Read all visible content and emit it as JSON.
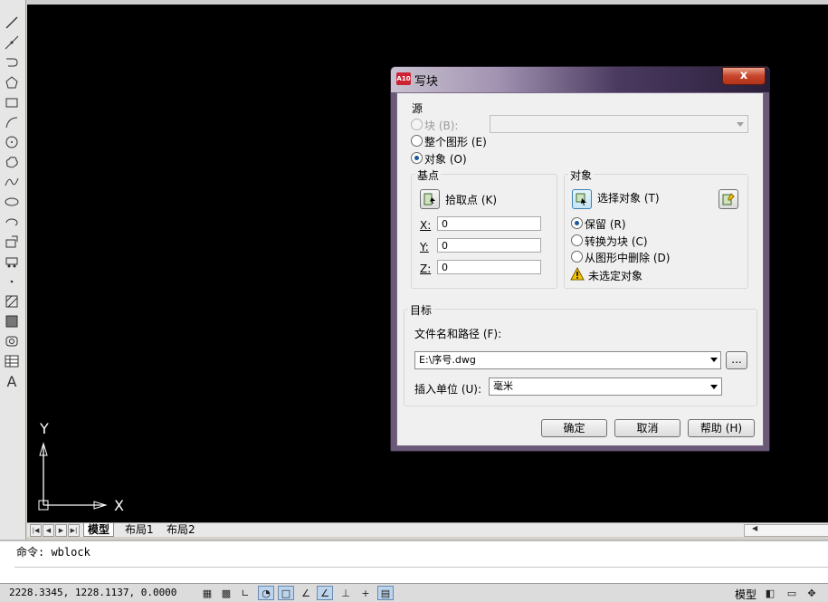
{
  "layout_tabs": [
    "模型",
    "布局1",
    "布局2"
  ],
  "command": {
    "text": "命令: wblock"
  },
  "status": {
    "coords": "2228.3345, 1228.1137, 0.0000",
    "space": "模型"
  },
  "ucs": {
    "x_label": "X",
    "y_label": "Y"
  },
  "dialog": {
    "title": "写块",
    "close_label": "x",
    "source": {
      "label": "源",
      "block_label": "块 (B):",
      "entire_label": "整个图形 (E)",
      "objects_label": "对象 (O)",
      "selected": "objects"
    },
    "base_point": {
      "label": "基点",
      "pick_label": "拾取点 (K)",
      "x_label": "X:",
      "x_value": "0",
      "y_label": "Y:",
      "y_value": "0",
      "z_label": "Z:",
      "z_value": "0"
    },
    "objects": {
      "label": "对象",
      "select_label": "选择对象 (T)",
      "retain_label": "保留 (R)",
      "convert_label": "转换为块 (C)",
      "delete_label": "从图形中删除 (D)",
      "selected": "retain",
      "warning": "未选定对象"
    },
    "destination": {
      "label": "目标",
      "path_label": "文件名和路径 (F):",
      "path_value": "E:\\序号.dwg",
      "browse_label": "...",
      "units_label": "插入单位 (U):",
      "units_value": "毫米"
    },
    "buttons": {
      "ok": "确定",
      "cancel": "取消",
      "help": "帮助 (H)"
    }
  },
  "colors": {
    "canvas": "#000000",
    "title_dark": "#2a1f3a",
    "close": "#c8452b"
  }
}
